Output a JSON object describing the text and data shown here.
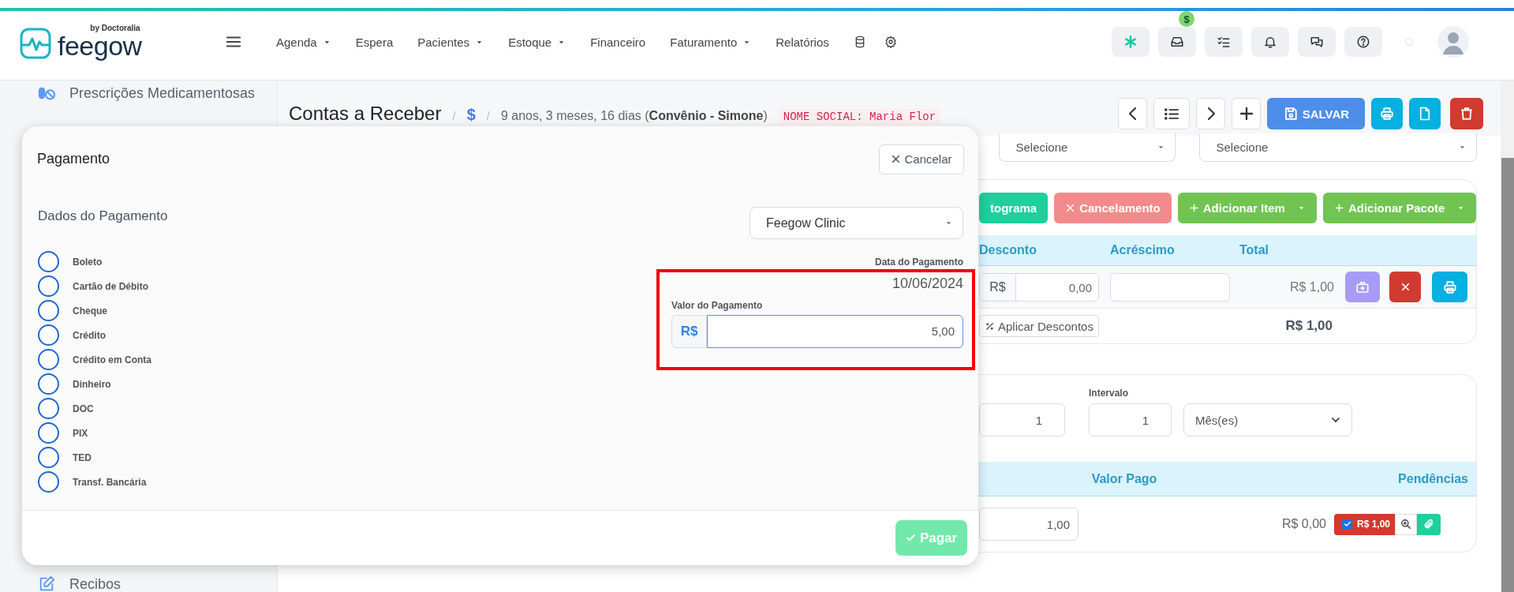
{
  "topbar": {
    "logo": "feegow",
    "logo_tagline": "by Doctoralia",
    "nav": [
      {
        "label": "Agenda",
        "dropdown": true
      },
      {
        "label": "Espera",
        "dropdown": false
      },
      {
        "label": "Pacientes",
        "dropdown": true
      },
      {
        "label": "Estoque",
        "dropdown": true
      },
      {
        "label": "Financeiro",
        "dropdown": false
      },
      {
        "label": "Faturamento",
        "dropdown": true
      },
      {
        "label": "Relatórios",
        "dropdown": false
      }
    ],
    "inbox_badge": "$"
  },
  "sidebar": {
    "items": [
      {
        "label": "Prescrições Medicamentosas",
        "kind": "medication"
      },
      {
        "label": "Recibos",
        "kind": "receipt"
      }
    ]
  },
  "page": {
    "title": "Contas a Receber",
    "breadcrumb": [
      {
        "kind": "separator",
        "text": "/"
      },
      {
        "kind": "link",
        "text": "$"
      },
      {
        "kind": "separator",
        "text": "/"
      }
    ],
    "patient_info": "9 anos, 3 meses, 16 dias (**Convênio - Simone**)",
    "social_name": "NOME SOCIAL: Maria Flor",
    "save_label": "SALVAR"
  },
  "filters": [
    "Selecione",
    "Selecione"
  ],
  "items_card": {
    "actions": [
      {
        "label": "tograma",
        "kind": "teal",
        "dropdown": false
      },
      {
        "label": "Cancelamento",
        "kind": "cancel",
        "dropdown": false
      },
      {
        "label": "Adicionar Item",
        "kind": "add",
        "dropdown": true
      },
      {
        "label": "Adicionar Pacote",
        "kind": "add",
        "dropdown": true
      }
    ],
    "columns": [
      "Desconto",
      "Acréscimo",
      "Total"
    ],
    "row": {
      "discount_prefix": "R$",
      "discount": "0,00",
      "total": "R$ 1,00"
    },
    "apply_button": "Aplicar Descontos",
    "sum": "R$ 1,00"
  },
  "installments": {
    "interval_label": "Intervalo",
    "count": "1",
    "interval": "1",
    "unit": "Mês(es)",
    "columns": [
      "Valor Pago",
      "Pendências"
    ],
    "row": {
      "paid_input": "1,00",
      "paid": "R$ 0,00",
      "pending_checked": true,
      "pending": "R$ 1,00"
    }
  },
  "modal": {
    "title": "Pagamento",
    "cancel": "Cancelar",
    "section": "Dados do Pagamento",
    "methods": [
      {
        "label": "Boleto",
        "selected": false
      },
      {
        "label": "Cartão de Débito",
        "selected": false
      },
      {
        "label": "Cheque",
        "selected": false
      },
      {
        "label": "Crédito",
        "selected": false
      },
      {
        "label": "Crédito em Conta",
        "selected": false
      },
      {
        "label": "Dinheiro",
        "selected": false
      },
      {
        "label": "DOC",
        "selected": false
      },
      {
        "label": "PIX",
        "selected": false
      },
      {
        "label": "TED",
        "selected": false
      },
      {
        "label": "Transf. Bancária",
        "selected": false
      }
    ],
    "unit_select": "Feegow Clinic",
    "date_label": "Data do Pagamento",
    "date": "10/06/2024",
    "amount_label": "Valor do Pagamento",
    "currency": "R$",
    "amount": "5,00",
    "highlighted": true,
    "pay": "Pagar",
    "pay_disabled": true
  }
}
